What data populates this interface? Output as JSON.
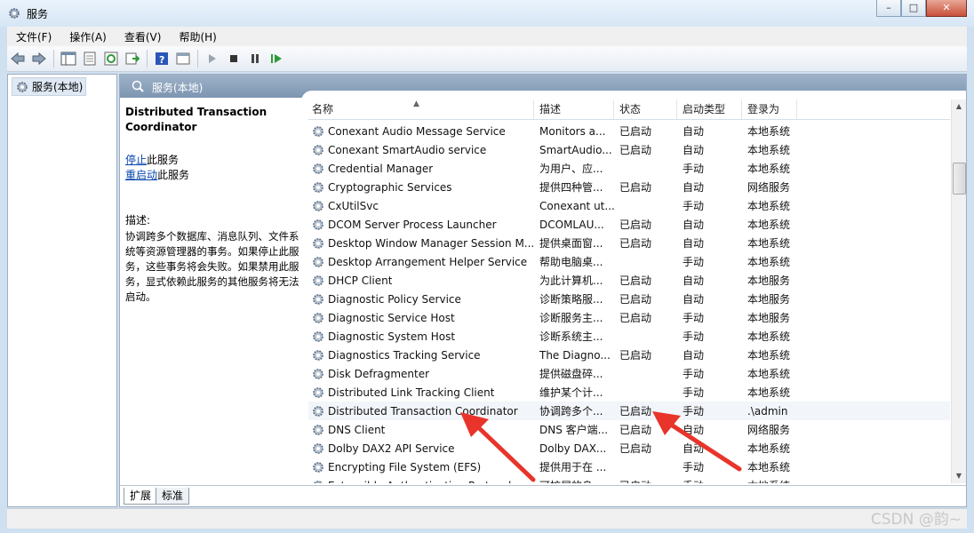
{
  "window": {
    "title": "服务"
  },
  "menu": [
    "文件(F)",
    "操作(A)",
    "查看(V)",
    "帮助(H)"
  ],
  "tree": {
    "item": "服务(本地)"
  },
  "pane": {
    "header": "服务(本地)",
    "service_name": "Distributed Transaction Coordinator",
    "stop_link": "停止",
    "stop_suffix": "此服务",
    "restart_link": "重启动",
    "restart_suffix": "此服务",
    "desc_label": "描述:",
    "desc_text": "协调跨多个数据库、消息队列、文件系统等资源管理器的事务。如果停止此服务，这些事务将会失败。如果禁用此服务，显式依赖此服务的其他服务将无法启动。"
  },
  "table": {
    "columns": [
      "名称",
      "描述",
      "状态",
      "启动类型",
      "登录为"
    ],
    "rows": [
      [
        "Conexant Audio Message Service",
        "Monitors a...",
        "已启动",
        "自动",
        "本地系统"
      ],
      [
        "Conexant SmartAudio service",
        "SmartAudio...",
        "已启动",
        "自动",
        "本地系统"
      ],
      [
        "Credential Manager",
        "为用户、应...",
        "",
        "手动",
        "本地系统"
      ],
      [
        "Cryptographic Services",
        "提供四种管...",
        "已启动",
        "自动",
        "网络服务"
      ],
      [
        "CxUtilSvc",
        "Conexant ut...",
        "",
        "手动",
        "本地系统"
      ],
      [
        "DCOM Server Process Launcher",
        "DCOMLAU...",
        "已启动",
        "自动",
        "本地系统"
      ],
      [
        "Desktop Window Manager Session M...",
        "提供桌面窗...",
        "已启动",
        "自动",
        "本地系统"
      ],
      [
        "Desktop Arrangement Helper Service",
        "帮助电脑桌...",
        "",
        "手动",
        "本地系统"
      ],
      [
        "DHCP Client",
        "为此计算机...",
        "已启动",
        "自动",
        "本地服务"
      ],
      [
        "Diagnostic Policy Service",
        "诊断策略服...",
        "已启动",
        "自动",
        "本地服务"
      ],
      [
        "Diagnostic Service Host",
        "诊断服务主...",
        "已启动",
        "手动",
        "本地服务"
      ],
      [
        "Diagnostic System Host",
        "诊断系统主...",
        "",
        "手动",
        "本地系统"
      ],
      [
        "Diagnostics Tracking Service",
        "The Diagno...",
        "已启动",
        "自动",
        "本地系统"
      ],
      [
        "Disk Defragmenter",
        "提供磁盘碎...",
        "",
        "手动",
        "本地系统"
      ],
      [
        "Distributed Link Tracking Client",
        "维护某个计...",
        "",
        "手动",
        "本地系统"
      ],
      [
        "Distributed Transaction Coordinator",
        "协调跨多个...",
        "已启动",
        "手动",
        ".\\admin"
      ],
      [
        "DNS Client",
        "DNS 客户端...",
        "已启动",
        "自动",
        "网络服务"
      ],
      [
        "Dolby DAX2 API Service",
        "Dolby DAX...",
        "已启动",
        "自动",
        "本地系统"
      ],
      [
        "Encrypting File System (EFS)",
        "提供用于在 ...",
        "",
        "手动",
        "本地系统"
      ],
      [
        "Extensible Authentication Protocol",
        "可扩展的身...",
        "已启动",
        "手动",
        "本地系统"
      ]
    ],
    "selected_index": 15
  },
  "tabs": [
    "扩展",
    "标准"
  ],
  "watermark": "CSDN @韵~",
  "colors": {
    "arrow": "#e8342a",
    "header": "#8aa0bb",
    "link": "#0645ad"
  }
}
